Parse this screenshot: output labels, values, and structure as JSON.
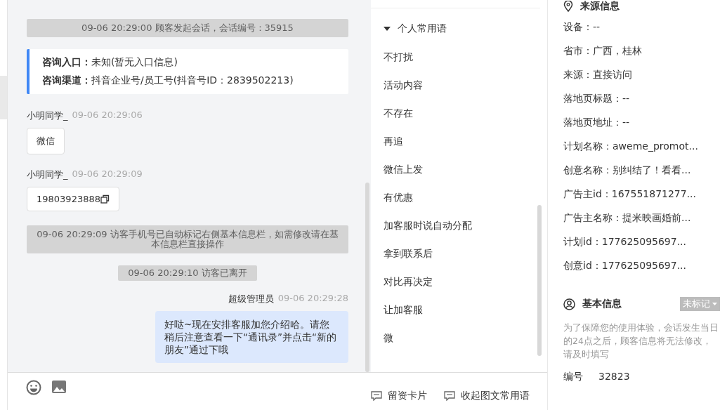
{
  "chat": {
    "messages": [
      {
        "kind": "notice",
        "text": "09-06 20:29:00 顾客发起会话，会话编号：35915"
      },
      {
        "kind": "entry",
        "rows": [
          {
            "label": "咨询入口：",
            "value": "未知(暂无入口信息)"
          },
          {
            "label": "咨询渠道：",
            "value": "抖音企业号/员工号(抖音号ID：2839502213)"
          }
        ]
      },
      {
        "kind": "visitor",
        "sender": "小明同学_",
        "time": "09-06 20:29:06",
        "text": "微信",
        "copyable": false
      },
      {
        "kind": "visitor",
        "sender": "小明同学_",
        "time": "09-06 20:29:09",
        "text": "19803923888",
        "copyable": true
      },
      {
        "kind": "notice",
        "text": "09-06 20:29:09 访客手机号已自动标记右侧基本信息栏，如需修改请在基本信息栏直接操作"
      },
      {
        "kind": "notice",
        "text": "09-06 20:29:10 访客已离开"
      },
      {
        "kind": "agent",
        "sender": "超级管理员",
        "time": "09-06 20:29:28",
        "text": "好哒~现在安排客服加您介绍哈。请您稍后注意查看一下“通讯录”并点击“新的朋友”通过下哦"
      }
    ]
  },
  "phrases": {
    "group": {
      "label": "个人常用语",
      "expanded": true
    },
    "items": [
      "不打扰",
      "活动内容",
      "不存在",
      "再追",
      "微信上发",
      "有优惠",
      "加客服时说自动分配",
      "拿到联系后",
      "对比再决定",
      "让加客服",
      "微"
    ],
    "actions": [
      {
        "label": "留资卡片"
      },
      {
        "label": "收起图文常用语"
      }
    ]
  },
  "info": {
    "source": {
      "title": "来源信息",
      "fields": [
        "设备：--",
        "省市：广西，桂林",
        "来源：直接访问",
        "落地页标题：--",
        "落地页地址：--",
        "计划名称：aweme_promot...",
        "创意名称：别纠结了！看看...",
        "广告主id：167551871277...",
        "广告主名称：提米映画婚前...",
        "计划id：177625095697...",
        "创意id：177625095697..."
      ]
    },
    "basic": {
      "title": "基本信息",
      "tag": "未标记",
      "notice": "为了保障您的使用体验，会话发生当日的24点之后，顾客信息将无法修改，请及时填写",
      "fields": [
        {
          "label": "编号",
          "value": "32823"
        }
      ]
    }
  }
}
